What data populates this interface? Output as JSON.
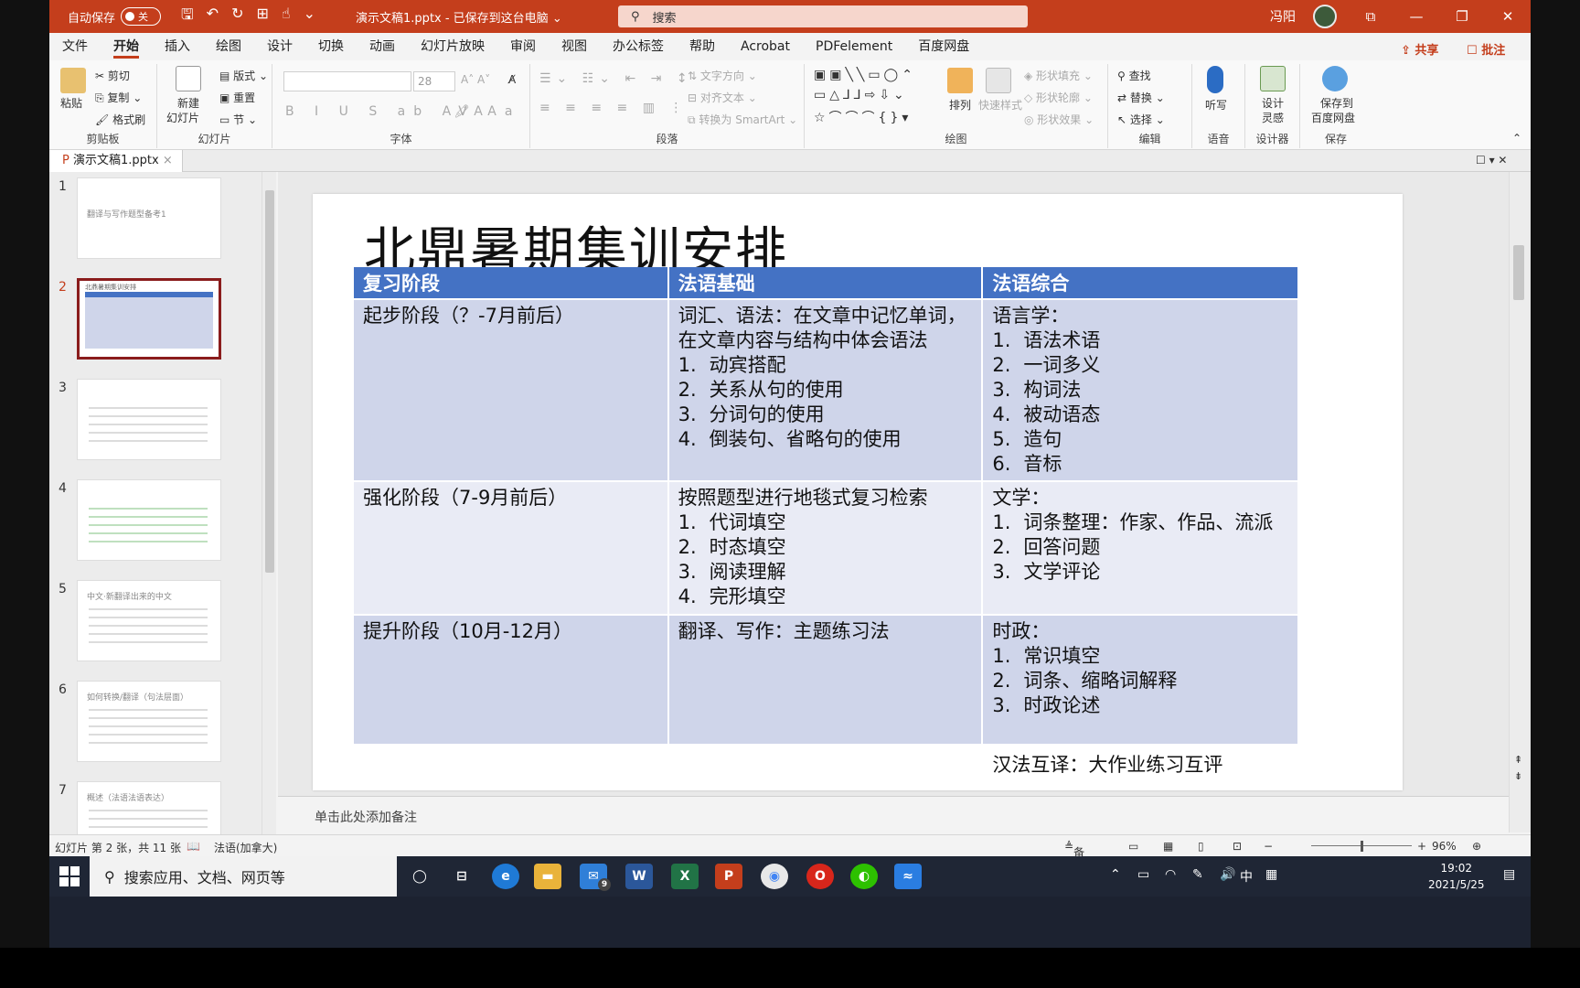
{
  "titlebar": {
    "autosave_label": "自动保存",
    "autosave_state": "关",
    "doc_title": "演示文稿1.pptx  -  已保存到这台电脑 ⌄",
    "search_placeholder": "搜索",
    "user_name": "冯阳"
  },
  "menu": {
    "tabs": [
      "文件",
      "开始",
      "插入",
      "绘图",
      "设计",
      "切换",
      "动画",
      "幻灯片放映",
      "审阅",
      "视图",
      "办公标签",
      "帮助",
      "Acrobat",
      "PDFelement",
      "百度网盘"
    ],
    "active": "开始",
    "share": "共享",
    "comment": "批注"
  },
  "ribbon": {
    "clipboard": {
      "label": "剪贴板",
      "paste": "粘贴",
      "cut": "剪切",
      "copy": "复制",
      "format_painter": "格式刷"
    },
    "slides": {
      "label": "幻灯片",
      "new_slide": "新建",
      "new_slide2": "幻灯片",
      "layout": "版式",
      "reset": "重置",
      "section": "节"
    },
    "font": {
      "label": "字体",
      "size": "28"
    },
    "paragraph": {
      "label": "段落",
      "text_direction": "文字方向",
      "align_text": "对齐文本",
      "smartart": "转换为 SmartArt"
    },
    "drawing": {
      "label": "绘图",
      "arrange": "排列",
      "quick_styles": "快速样式",
      "fill": "形状填充",
      "outline": "形状轮廓",
      "effects": "形状效果"
    },
    "editing": {
      "label": "编辑",
      "find": "查找",
      "replace": "替换",
      "select": "选择"
    },
    "voice": {
      "label": "语音",
      "dictate": "听写"
    },
    "designer": {
      "label": "设计器",
      "design_ideas": "设计",
      "design_ideas2": "灵感"
    },
    "save": {
      "label": "保存",
      "save_baidu": "保存到",
      "save_baidu2": "百度网盘"
    }
  },
  "filetab": {
    "name": "演示文稿1.pptx"
  },
  "thumbnails": [
    {
      "num": "1",
      "text": "翻译与写作题型备考1"
    },
    {
      "num": "2",
      "text": "北鼎暑期集训安排"
    },
    {
      "num": "3",
      "text": ""
    },
    {
      "num": "4",
      "text": ""
    },
    {
      "num": "5",
      "text": "中文·新翻译出来的中文"
    },
    {
      "num": "6",
      "text": "如何转换/翻译（句法层面）"
    },
    {
      "num": "7",
      "text": "概述（法语法语表达）"
    }
  ],
  "slide": {
    "title": "北鼎暑期集训安排",
    "headers": [
      "复习阶段",
      "法语基础",
      "法语综合"
    ],
    "rows": [
      {
        "stage": "起步阶段（？-7月前后）",
        "base_intro": "词汇、语法：在文章中记忆单词，在文章内容与结构中体会语法",
        "base_items": [
          "动宾搭配",
          "关系从句的使用",
          "分词句的使用",
          "倒装句、省略句的使用"
        ],
        "comp_intro": "语言学：",
        "comp_items": [
          "语法术语",
          "一词多义",
          "构词法",
          "被动语态",
          "造句",
          "音标"
        ]
      },
      {
        "stage": "强化阶段（7-9月前后）",
        "base_intro": "按照题型进行地毯式复习检索",
        "base_items": [
          "代词填空",
          "时态填空",
          "阅读理解",
          "完形填空"
        ],
        "comp_intro": "文学：",
        "comp_items": [
          "词条整理：作家、作品、流派",
          "回答问题",
          "文学评论"
        ]
      },
      {
        "stage": "提升阶段（10月-12月）",
        "base_intro": "翻译、写作：主题练习法",
        "base_items": [],
        "comp_intro": "时政：",
        "comp_items": [
          "常识填空",
          "词条、缩略词解释",
          "时政论述"
        ]
      }
    ],
    "footer_cell": "汉法互译：大作业练习互评"
  },
  "notes_placeholder": "单击此处添加备注",
  "status": {
    "slide_info": "幻灯片 第 2 张，共 11 张",
    "language": "法语(加拿大)",
    "notes_btn": "备注",
    "zoom": "96%"
  },
  "taskbar": {
    "search": "搜索应用、文档、网页等",
    "mail_badge": "9",
    "ime": "中",
    "time": "19:02",
    "date": "2021/5/25"
  },
  "colors": {
    "accent": "#c43e1c",
    "table_header": "#4472c4",
    "row_dark": "#cfd5ea",
    "row_light": "#e9ebf5"
  }
}
